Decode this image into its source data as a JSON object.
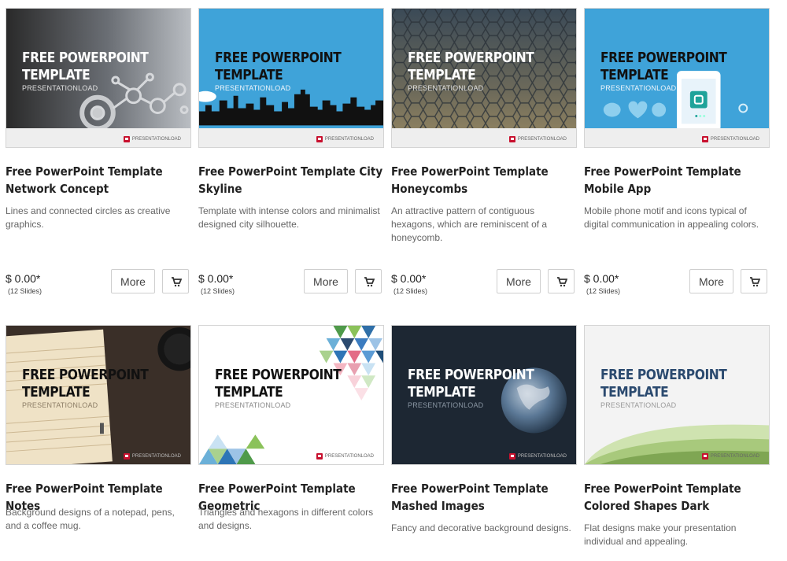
{
  "row1": [
    {
      "thumb": {
        "line1": "FREE POWERPOINT",
        "line2": "TEMPLATE",
        "line3": "PRESENTATIONLOAD",
        "brand": "PRESENTATIONLOAD"
      },
      "title": "Free PowerPoint Template Network Concept",
      "description": "Lines and connected circles as creative graphics.",
      "price": "$ 0.00*",
      "slides": "(12 Slides)",
      "more_label": "More"
    },
    {
      "thumb": {
        "line1": "FREE POWERPOINT",
        "line2": "TEMPLATE",
        "line3": "PRESENTATIONLOAD",
        "brand": "PRESENTATIONLOAD"
      },
      "title": "Free PowerPoint Template City Skyline",
      "description": "Template with intense colors and minimalist designed city silhouette.",
      "price": "$ 0.00*",
      "slides": "(12 Slides)",
      "more_label": "More"
    },
    {
      "thumb": {
        "line1": "FREE POWERPOINT",
        "line2": "TEMPLATE",
        "line3": "PRESENTATIONLOAD",
        "brand": "PRESENTATIONLOAD"
      },
      "title": "Free PowerPoint Template Honeycombs",
      "description": "An attractive pattern of contiguous hexagons, which are reminiscent of a honeycomb.",
      "price": "$ 0.00*",
      "slides": "(12 Slides)",
      "more_label": "More"
    },
    {
      "thumb": {
        "line1": "FREE POWERPOINT",
        "line2": "TEMPLATE",
        "line3": "PRESENTATIONLOAD",
        "brand": "PRESENTATIONLOAD"
      },
      "title": "Free PowerPoint Template Mobile App",
      "description": "Mobile phone motif and icons typical of digital communication in appealing colors.",
      "price": "$ 0.00*",
      "slides": "(12 Slides)",
      "more_label": "More"
    }
  ],
  "row2": [
    {
      "thumb": {
        "line1": "FREE POWERPOINT",
        "line2": "TEMPLATE",
        "line3": "PRESENTATIONLOAD",
        "brand": "PRESENTATIONLOAD"
      },
      "title": "Free PowerPoint Template Notes",
      "description": "Background designs of a notepad, pens, and a coffee mug."
    },
    {
      "thumb": {
        "line1": "FREE POWERPOINT",
        "line2": "TEMPLATE",
        "line3": "PRESENTATIONLOAD",
        "brand": "PRESENTATIONLOAD"
      },
      "title": "Free PowerPoint Template Geometric",
      "description": "Triangles and hexagons in different colors and designs."
    },
    {
      "thumb": {
        "line1": "FREE POWERPOINT",
        "line2": "TEMPLATE",
        "line3": "PRESENTATIONLOAD",
        "brand": "PRESENTATIONLOAD"
      },
      "title": "Free PowerPoint Template Mashed Images",
      "description": "Fancy and decorative background designs."
    },
    {
      "thumb": {
        "line1": "FREE POWERPOINT",
        "line2": "TEMPLATE",
        "line3": "PRESENTATIONLOAD",
        "brand": "PRESENTATIONLOAD"
      },
      "title": "Free PowerPoint Template Colored Shapes Dark",
      "description": "Flat designs make your presentation individual and appealing."
    }
  ],
  "icons": {
    "cart": "shopping-cart-icon",
    "brand_logo": "presentationload-logo-icon"
  },
  "colors": {
    "brand_red": "#c8102e",
    "sky_blue": "#3fa3d9",
    "title_navy": "#2b4a6f"
  }
}
